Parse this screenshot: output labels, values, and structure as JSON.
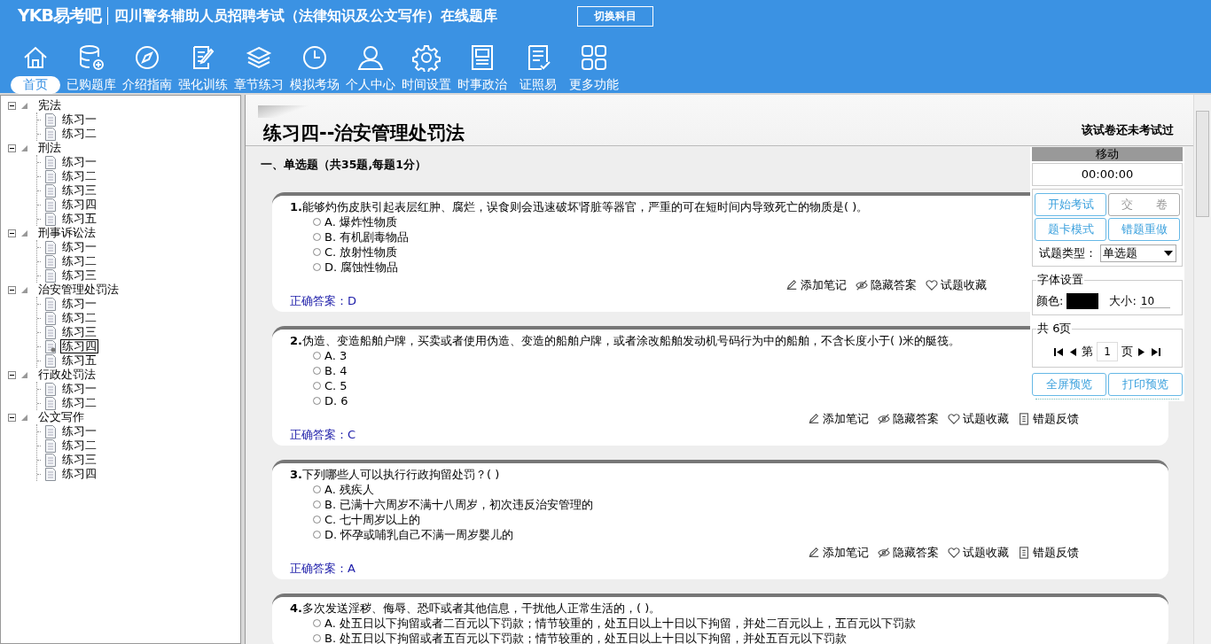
{
  "header": {
    "logo": "YKB易考吧",
    "title": "四川警务辅助人员招聘考试（法律知识及公文写作）在线题库",
    "switch_button": "切换科目"
  },
  "nav": [
    {
      "label": "首页",
      "selected": true
    },
    {
      "label": "已购题库",
      "selected": false
    },
    {
      "label": "介绍指南",
      "selected": false
    },
    {
      "label": "强化训练",
      "selected": false
    },
    {
      "label": "章节练习",
      "selected": false
    },
    {
      "label": "模拟考场",
      "selected": false
    },
    {
      "label": "个人中心",
      "selected": false
    },
    {
      "label": "时间设置",
      "selected": false
    },
    {
      "label": "时事政治",
      "selected": false
    },
    {
      "label": "证照易",
      "selected": false
    },
    {
      "label": "更多功能",
      "selected": false
    }
  ],
  "tree": [
    {
      "label": "宪法",
      "expanded": true,
      "children": [
        {
          "label": "练习一",
          "selected": false
        },
        {
          "label": "练习二",
          "selected": false
        }
      ]
    },
    {
      "label": "刑法",
      "expanded": true,
      "children": [
        {
          "label": "练习一",
          "selected": false
        },
        {
          "label": "练习二",
          "selected": false
        },
        {
          "label": "练习三",
          "selected": false
        },
        {
          "label": "练习四",
          "selected": false
        },
        {
          "label": "练习五",
          "selected": false
        }
      ]
    },
    {
      "label": "刑事诉讼法",
      "expanded": true,
      "children": [
        {
          "label": "练习一",
          "selected": false
        },
        {
          "label": "练习二",
          "selected": false
        },
        {
          "label": "练习三",
          "selected": false
        }
      ]
    },
    {
      "label": "治安管理处罚法",
      "expanded": true,
      "children": [
        {
          "label": "练习一",
          "selected": false
        },
        {
          "label": "练习二",
          "selected": false
        },
        {
          "label": "练习三",
          "selected": false
        },
        {
          "label": "练习四",
          "selected": true
        },
        {
          "label": "练习五",
          "selected": false
        }
      ]
    },
    {
      "label": "行政处罚法",
      "expanded": true,
      "children": [
        {
          "label": "练习一",
          "selected": false
        },
        {
          "label": "练习二",
          "selected": false
        }
      ]
    },
    {
      "label": "公文写作",
      "expanded": true,
      "children": [
        {
          "label": "练习一",
          "selected": false
        },
        {
          "label": "练习二",
          "selected": false
        },
        {
          "label": "练习三",
          "selected": false
        },
        {
          "label": "练习四",
          "selected": false
        }
      ]
    }
  ],
  "paper": {
    "title": "练习四--治安管理处罚法",
    "status": "该试卷还未考试过",
    "section": "一、单选题（共35题,每题1分）"
  },
  "questions": [
    {
      "number": "1.",
      "text": "能够灼伤皮肤引起表层红肿、腐烂，误食则会迅速破坏肾脏等器官，严重的可在短时间内导致死亡的物质是( )。",
      "options": [
        {
          "label": "A. 爆炸性物质",
          "selected": false
        },
        {
          "label": "B. 有机剧毒物品",
          "selected": false
        },
        {
          "label": "C. 放射性物质",
          "selected": false
        },
        {
          "label": "D. 腐蚀性物品",
          "selected": false
        }
      ],
      "actions": [
        "添加笔记",
        "隐藏答案",
        "试题收藏"
      ],
      "answer_label": "正确答案：",
      "answer": "D"
    },
    {
      "number": "2.",
      "text": "伪造、变造船舶户牌，买卖或者使用伪造、变造的船舶户牌，或者涂改船舶发动机号码行为中的船舶，不含长度小于( )米的艇筏。",
      "options": [
        {
          "label": "A. 3",
          "selected": false
        },
        {
          "label": "B. 4",
          "selected": false
        },
        {
          "label": "C. 5",
          "selected": false
        },
        {
          "label": "D. 6",
          "selected": false
        }
      ],
      "actions": [
        "添加笔记",
        "隐藏答案",
        "试题收藏",
        "错题反馈"
      ],
      "answer_label": "正确答案：",
      "answer": "C"
    },
    {
      "number": "3.",
      "text": "下列哪些人可以执行行政拘留处罚？( )",
      "options": [
        {
          "label": "A. 残疾人",
          "selected": false
        },
        {
          "label": "B. 已满十六周岁不满十八周岁，初次违反治安管理的",
          "selected": false
        },
        {
          "label": "C. 七十周岁以上的",
          "selected": false
        },
        {
          "label": "D. 怀孕或哺乳自己不满一周岁婴儿的",
          "selected": false
        }
      ],
      "actions": [
        "添加笔记",
        "隐藏答案",
        "试题收藏",
        "错题反馈"
      ],
      "answer_label": "正确答案：",
      "answer": "A"
    },
    {
      "number": "4.",
      "text": "多次发送淫秽、侮辱、恐吓或者其他信息，干扰他人正常生活的，( )。",
      "options": [
        {
          "label": "A. 处五日以下拘留或者二百元以下罚款；情节较重的，处五日以上十日以下拘留，并处二百元以上，五百元以下罚款",
          "selected": false
        },
        {
          "label": "B. 处五日以下拘留或者五百元以下罚款；情节较重的，处五日以上十日以下拘留，并处五百元以下罚款",
          "selected": false
        }
      ]
    }
  ],
  "panel": {
    "header": "移动",
    "timer": "00:00:00",
    "buttons": [
      {
        "label": "开始考试",
        "disabled": false
      },
      {
        "label": "交　　卷",
        "disabled": true
      },
      {
        "label": "题卡模式",
        "disabled": false
      },
      {
        "label": "错题重做",
        "disabled": false
      }
    ],
    "type_label": "试题类型：",
    "type_value": "单选题",
    "font_group": "字体设置",
    "color_label": "颜色:",
    "color": "#000000",
    "size_label": "大小:",
    "size_value": "10",
    "pages_group": "共 6页",
    "page_prefix": "第",
    "page_value": "1",
    "page_suffix": "页",
    "bottom_buttons": [
      {
        "label": "全屏预览",
        "disabled": false
      },
      {
        "label": "打印预览",
        "disabled": false
      }
    ]
  }
}
